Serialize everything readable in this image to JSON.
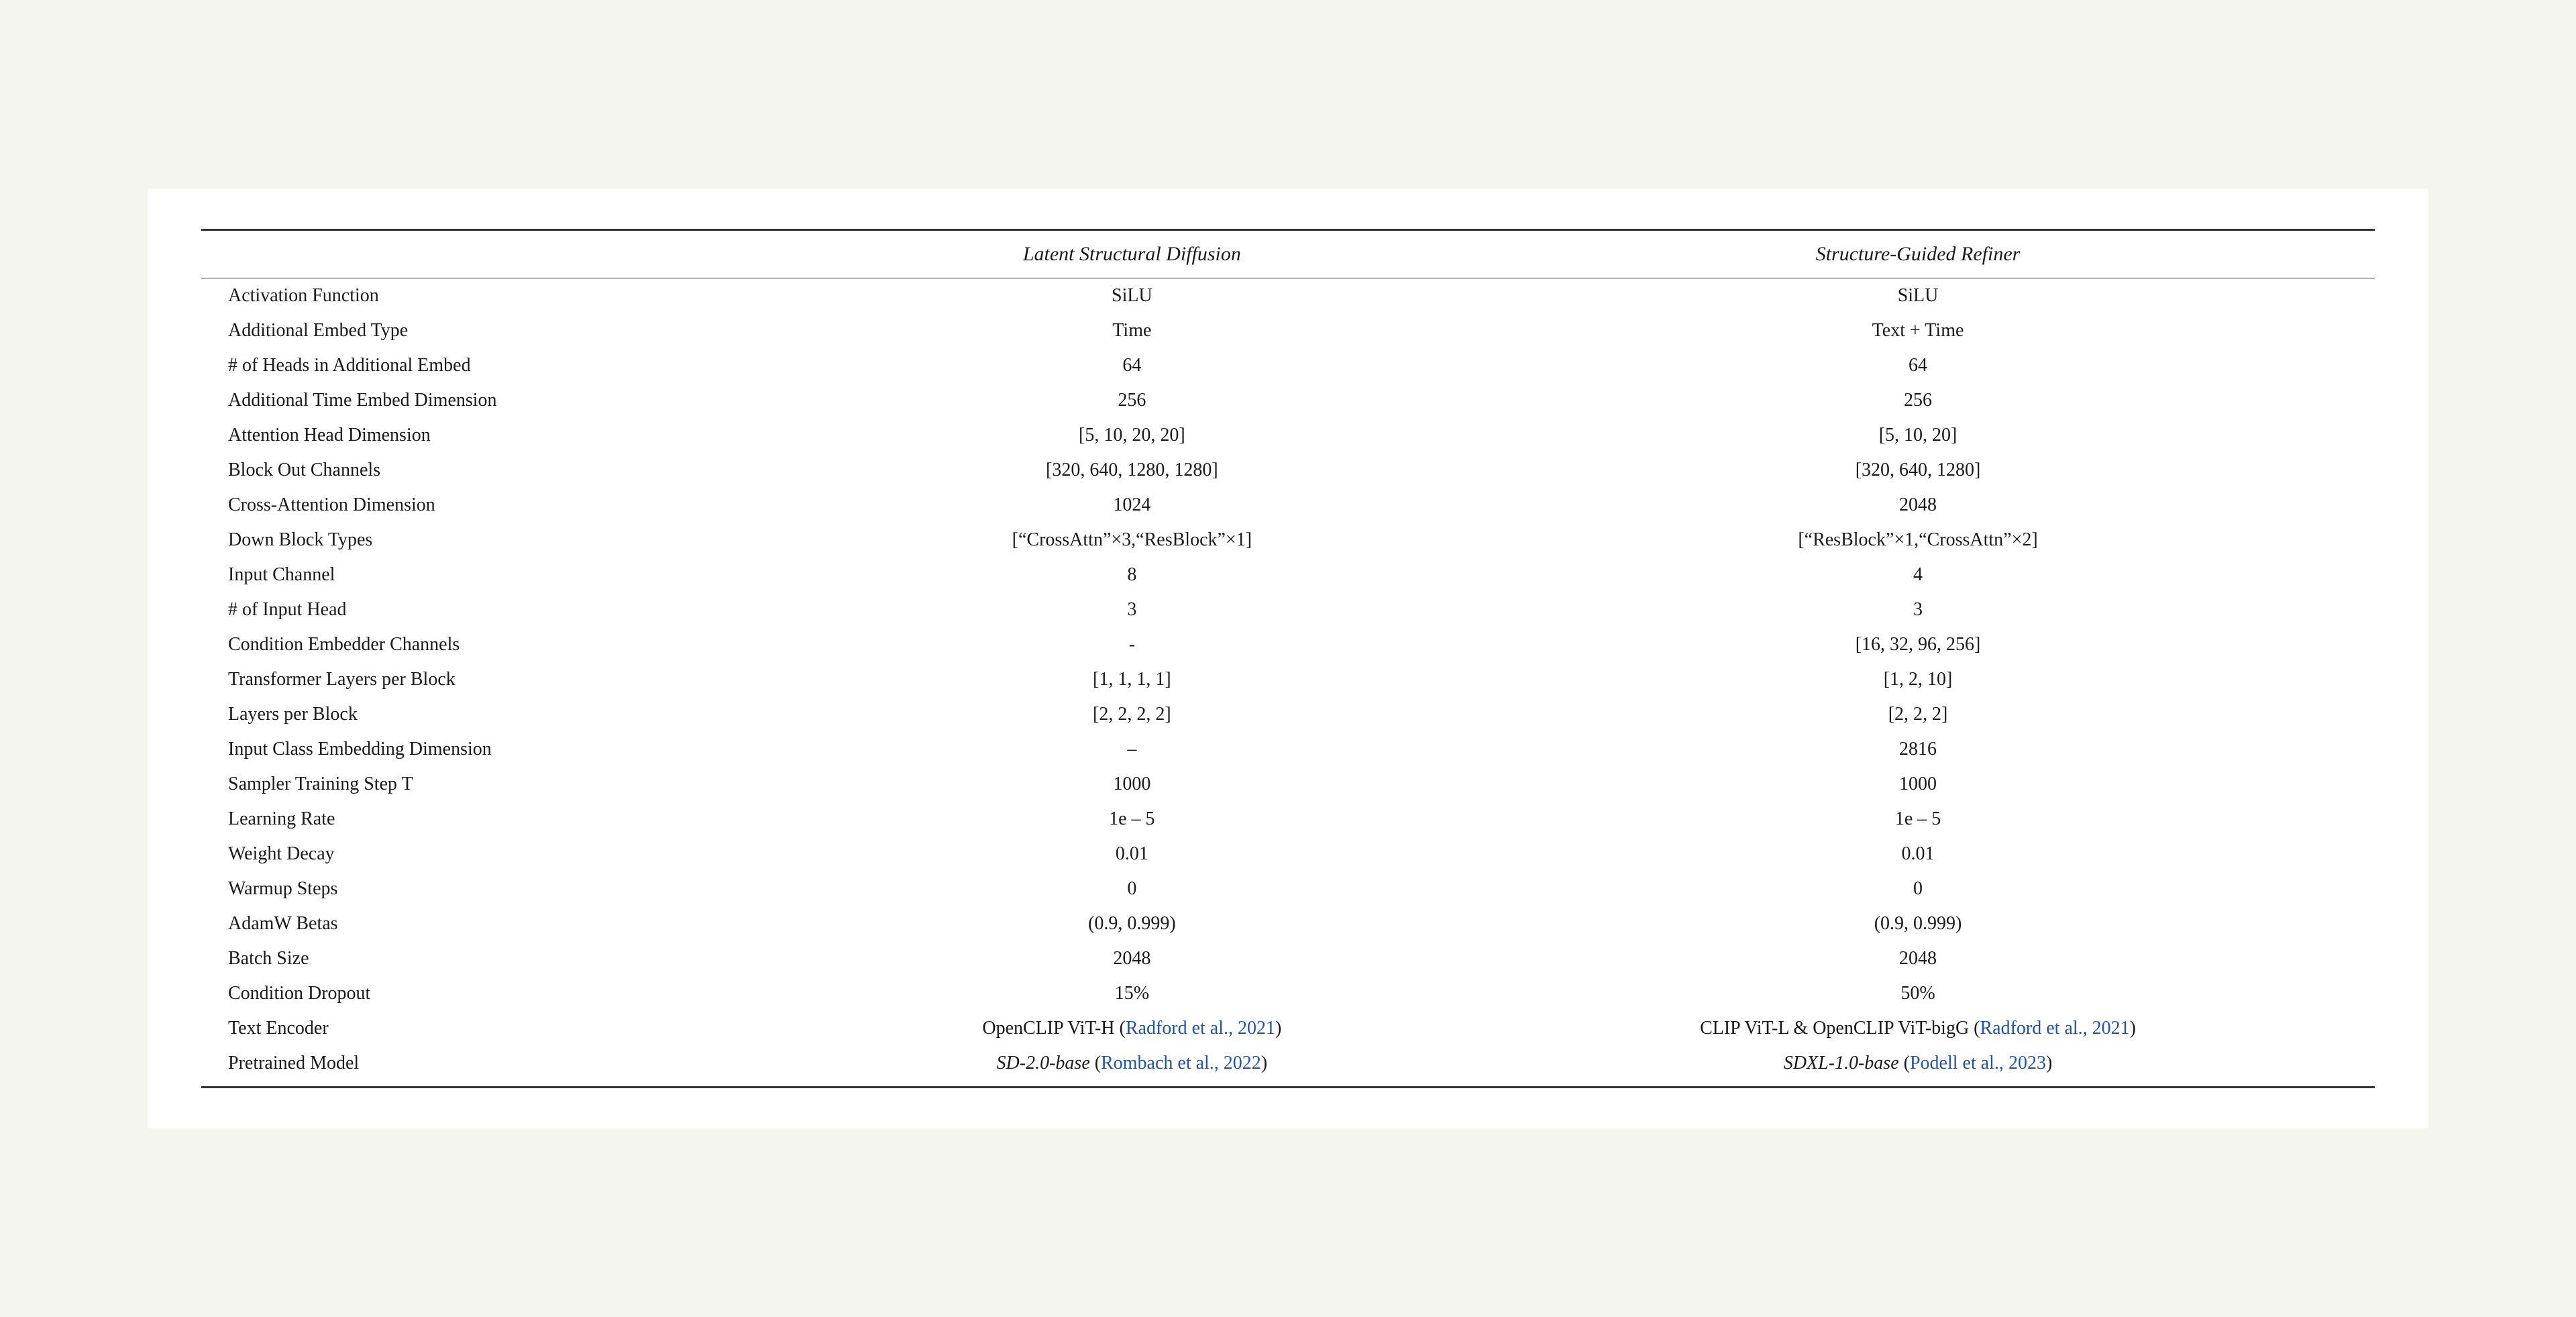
{
  "table": {
    "columns": [
      {
        "key": "property",
        "label": ""
      },
      {
        "key": "lsd",
        "label": "Latent Structural Diffusion"
      },
      {
        "key": "sgr",
        "label": "Structure-Guided Refiner"
      }
    ],
    "rows": [
      {
        "property": "Activation Function",
        "lsd": "SiLU",
        "sgr": "SiLU",
        "lsd_italic": false,
        "sgr_italic": false,
        "lsd_link": false,
        "sgr_link": false
      },
      {
        "property": "Additional Embed Type",
        "lsd": "Time",
        "sgr": "Text + Time",
        "lsd_italic": false,
        "sgr_italic": false,
        "lsd_link": false,
        "sgr_link": false
      },
      {
        "property": "# of Heads in Additional Embed",
        "lsd": "64",
        "sgr": "64",
        "lsd_italic": false,
        "sgr_italic": false,
        "lsd_link": false,
        "sgr_link": false
      },
      {
        "property": "Additional Time Embed Dimension",
        "lsd": "256",
        "sgr": "256",
        "lsd_italic": false,
        "sgr_italic": false,
        "lsd_link": false,
        "sgr_link": false
      },
      {
        "property": "Attention Head Dimension",
        "lsd": "[5, 10, 20, 20]",
        "sgr": "[5, 10, 20]",
        "lsd_italic": false,
        "sgr_italic": false,
        "lsd_link": false,
        "sgr_link": false
      },
      {
        "property": "Block Out Channels",
        "lsd": "[320, 640, 1280, 1280]",
        "sgr": "[320, 640, 1280]",
        "lsd_italic": false,
        "sgr_italic": false,
        "lsd_link": false,
        "sgr_link": false
      },
      {
        "property": "Cross-Attention Dimension",
        "lsd": "1024",
        "sgr": "2048",
        "lsd_italic": false,
        "sgr_italic": false,
        "lsd_link": false,
        "sgr_link": false
      },
      {
        "property": "Down Block Types",
        "lsd": "[“CrossAttn”×3,“ResBlock”×1]",
        "sgr": "[“ResBlock”×1,“CrossAttn”×2]",
        "lsd_italic": false,
        "sgr_italic": false,
        "lsd_link": false,
        "sgr_link": false
      },
      {
        "property": "Input Channel",
        "lsd": "8",
        "sgr": "4",
        "lsd_italic": false,
        "sgr_italic": false,
        "lsd_link": false,
        "sgr_link": false
      },
      {
        "property": "# of Input Head",
        "lsd": "3",
        "sgr": "3",
        "lsd_italic": false,
        "sgr_italic": false,
        "lsd_link": false,
        "sgr_link": false
      },
      {
        "property": "Condition Embedder Channels",
        "lsd": "-",
        "sgr": "[16, 32, 96, 256]",
        "lsd_italic": false,
        "sgr_italic": false,
        "lsd_link": false,
        "sgr_link": false
      },
      {
        "property": "Transformer Layers per Block",
        "lsd": "[1, 1, 1, 1]",
        "sgr": "[1, 2, 10]",
        "lsd_italic": false,
        "sgr_italic": false,
        "lsd_link": false,
        "sgr_link": false
      },
      {
        "property": "Layers per Block",
        "lsd": "[2, 2, 2, 2]",
        "sgr": "[2, 2, 2]",
        "lsd_italic": false,
        "sgr_italic": false,
        "lsd_link": false,
        "sgr_link": false
      },
      {
        "property": "Input Class Embedding Dimension",
        "lsd": "–",
        "sgr": "2816",
        "lsd_italic": false,
        "sgr_italic": false,
        "lsd_link": false,
        "sgr_link": false
      },
      {
        "property": "Sampler Training Step T",
        "lsd": "1000",
        "sgr": "1000",
        "lsd_italic": false,
        "sgr_italic": false,
        "lsd_link": false,
        "sgr_link": false
      },
      {
        "property": "Learning Rate",
        "lsd": "1e – 5",
        "sgr": "1e – 5",
        "lsd_italic": false,
        "sgr_italic": false,
        "lsd_link": false,
        "sgr_link": false
      },
      {
        "property": "Weight Decay",
        "lsd": "0.01",
        "sgr": "0.01",
        "lsd_italic": false,
        "sgr_italic": false,
        "lsd_link": false,
        "sgr_link": false
      },
      {
        "property": "Warmup Steps",
        "lsd": "0",
        "sgr": "0",
        "lsd_italic": false,
        "sgr_italic": false,
        "lsd_link": false,
        "sgr_link": false
      },
      {
        "property": "AdamW Betas",
        "lsd": "(0.9, 0.999)",
        "sgr": "(0.9, 0.999)",
        "lsd_italic": false,
        "sgr_italic": false,
        "lsd_link": false,
        "sgr_link": false
      },
      {
        "property": "Batch Size",
        "lsd": "2048",
        "sgr": "2048",
        "lsd_italic": false,
        "sgr_italic": false,
        "lsd_link": false,
        "sgr_link": false
      },
      {
        "property": "Condition Dropout",
        "lsd": "15%",
        "sgr": "50%",
        "lsd_italic": false,
        "sgr_italic": false,
        "lsd_link": false,
        "sgr_link": false
      },
      {
        "property": "Text Encoder",
        "lsd_parts": [
          {
            "text": "OpenCLIP ViT-H (",
            "italic": false,
            "link": false
          },
          {
            "text": "Radford et al., 2021",
            "italic": false,
            "link": true
          },
          {
            "text": ")",
            "italic": false,
            "link": false
          }
        ],
        "sgr_parts": [
          {
            "text": "CLIP ViT-L & OpenCLIP ViT-bigG (",
            "italic": false,
            "link": false
          },
          {
            "text": "Radford et al., 2021",
            "italic": false,
            "link": true
          },
          {
            "text": ")",
            "italic": false,
            "link": false
          }
        ],
        "complex": true
      },
      {
        "property": "Pretrained Model",
        "lsd_parts": [
          {
            "text": "SD-2.0-base",
            "italic": true,
            "link": false
          },
          {
            "text": " (",
            "italic": false,
            "link": false
          },
          {
            "text": "Rombach et al., 2022",
            "italic": false,
            "link": true
          },
          {
            "text": ")",
            "italic": false,
            "link": false
          }
        ],
        "sgr_parts": [
          {
            "text": "SDXL-1.0-base",
            "italic": true,
            "link": false
          },
          {
            "text": " (",
            "italic": false,
            "link": false
          },
          {
            "text": "Podell et al., 2023",
            "italic": false,
            "link": true
          },
          {
            "text": ")",
            "italic": false,
            "link": false
          }
        ],
        "complex": true,
        "last": true
      }
    ]
  }
}
